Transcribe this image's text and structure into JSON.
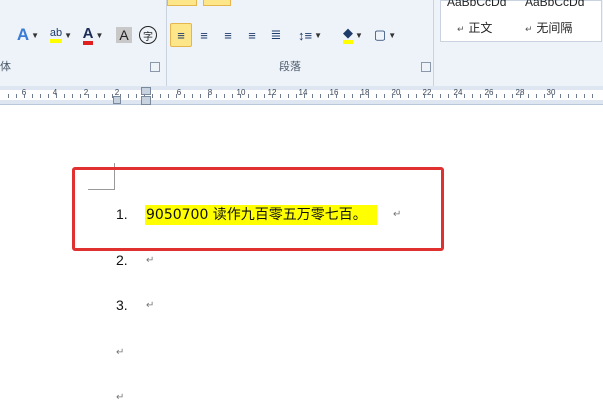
{
  "ribbon": {
    "font_group": {
      "label": "体",
      "buttons": [
        {
          "name": "text-effects",
          "glyph": "A"
        },
        {
          "name": "highlight-color",
          "glyph": "ab"
        },
        {
          "name": "font-color",
          "glyph": "A"
        },
        {
          "name": "char-shading",
          "glyph": "A"
        },
        {
          "name": "enclose-char",
          "glyph": "字"
        }
      ]
    },
    "paragraph_group": {
      "label": "段落",
      "align_left_glyph": "≡",
      "center_glyph": "≡",
      "align_right_glyph": "≡",
      "justify_glyph": "≡",
      "distributed_glyph": "≣",
      "line_spacing_glyph": "↕≡",
      "shading_glyph": "◆",
      "border_glyph": "▢"
    },
    "styles_group": {
      "preview_top_left": "AaBbCcDd",
      "preview_top_right": "AaBbCcDd",
      "style_normal": "正文",
      "style_no_spacing": "无间隔",
      "style_marker": "↵"
    }
  },
  "ruler": {
    "numbers": [
      "6",
      "4",
      "2",
      "2",
      "4",
      "6",
      "8",
      "10",
      "12",
      "14",
      "16",
      "18",
      "20",
      "22",
      "24",
      "26",
      "28",
      "30"
    ]
  },
  "document": {
    "list_items": [
      {
        "number": "1.",
        "text": "9050700 读作九百零五万零七百。"
      },
      {
        "number": "2.",
        "text": ""
      },
      {
        "number": "3.",
        "text": ""
      }
    ],
    "paragraph_mark": "↵",
    "highlight_color": "#ffff00",
    "annotation_color": "#e03030"
  }
}
